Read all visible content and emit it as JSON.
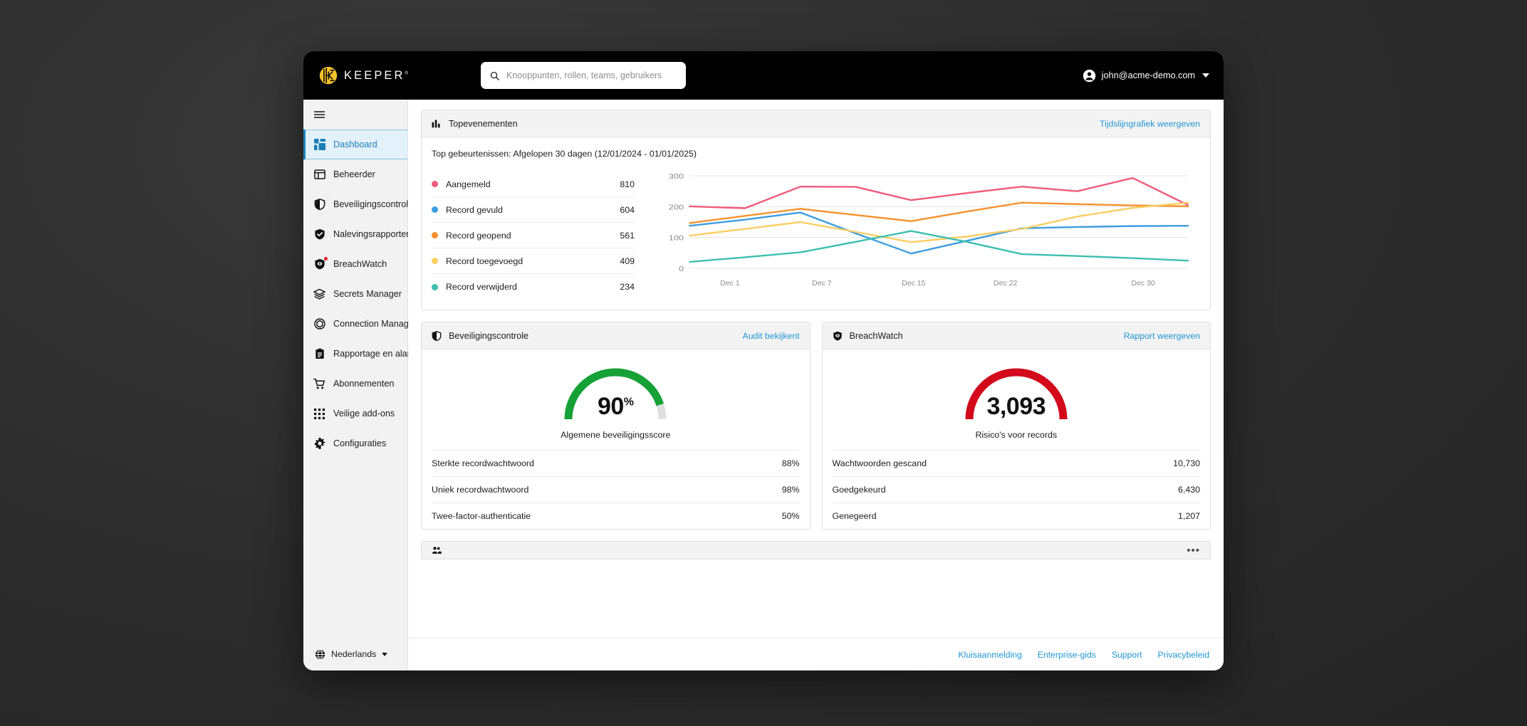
{
  "app": {
    "brand": "KEEPER",
    "brand_tm": "®"
  },
  "topbar": {
    "search": {
      "placeholder": "Knooppunten, rollen, teams, gebruikers",
      "value": "",
      "icon": "search-icon"
    },
    "user": {
      "email": "john@acme-demo.com",
      "avatar_icon": "account-circle-icon",
      "caret_icon": "chevron-down-icon"
    }
  },
  "sidebar": {
    "menu_toggle_icon": "hamburger-icon",
    "items": [
      {
        "label": "Dashboard",
        "icon": "dashboard-grid-icon",
        "active": true,
        "badge": false
      },
      {
        "label": "Beheerder",
        "icon": "admin-panel-icon",
        "active": false,
        "badge": false
      },
      {
        "label": "Beveiligingscontrole",
        "icon": "shield-outline-icon",
        "active": false,
        "badge": false
      },
      {
        "label": "Nalevingsrapporten",
        "icon": "shield-check-icon",
        "active": false,
        "badge": false
      },
      {
        "label": "BreachWatch",
        "icon": "breachwatch-shield-icon",
        "active": false,
        "badge": true
      },
      {
        "label": "Secrets Manager",
        "icon": "layers-icon",
        "active": false,
        "badge": false
      },
      {
        "label": "Connection Manager",
        "icon": "hexagon-node-icon",
        "active": false,
        "badge": false
      },
      {
        "label": "Rapportage en alarmen",
        "icon": "clipboard-icon",
        "active": false,
        "badge": false
      },
      {
        "label": "Abonnementen",
        "icon": "shopping-cart-icon",
        "active": false,
        "badge": false
      },
      {
        "label": "Veilige add-ons",
        "icon": "apps-grid-icon",
        "active": false,
        "badge": false
      },
      {
        "label": "Configuraties",
        "icon": "gear-icon",
        "active": false,
        "badge": false
      }
    ],
    "language": {
      "label": "Nederlands",
      "icon": "globe-icon",
      "caret_icon": "caret-down-icon"
    }
  },
  "top_events_card": {
    "title": "Topevenementen",
    "icon": "bar-chart-icon",
    "link": "Tijdslijngrafiek weergeven",
    "subtitle": "Top gebeurtenissen: Afgelopen 30 dagen (12/01/2024 - 01/01/2025)",
    "legend": [
      {
        "label": "Aangemeld",
        "value": "810",
        "color": "#ef5b7d"
      },
      {
        "label": "Record gevuld",
        "value": "604",
        "color": "#3d9de0"
      },
      {
        "label": "Record geopend",
        "value": "561",
        "color": "#f5922f"
      },
      {
        "label": "Record toegevoegd",
        "value": "409",
        "color": "#fbce62"
      },
      {
        "label": "Record verwijderd",
        "value": "234",
        "color": "#3cbfb0"
      }
    ]
  },
  "chart_data": {
    "type": "line",
    "title": "Top gebeurtenissen: Afgelopen 30 dagen (12/01/2024 - 01/01/2025)",
    "xlabel": "",
    "ylabel": "",
    "ylim": [
      0,
      300
    ],
    "yticks": [
      0,
      100,
      200,
      300
    ],
    "grid": true,
    "legend_position": "left",
    "x": [
      "Dec 1",
      "Dec 4",
      "Dec 7",
      "Dec 11",
      "Dec 15",
      "Dec 18",
      "Dec 22",
      "Dec 25",
      "Dec 27",
      "Dec 30"
    ],
    "xtick_labels": [
      "Dec 1",
      "Dec 7",
      "Dec 15",
      "Dec 22",
      "Dec 30"
    ],
    "series": [
      {
        "name": "Aangemeld",
        "color": "#ef5b7d",
        "total": 810,
        "values": [
          201,
          195,
          265,
          264,
          221,
          244,
          265,
          250,
          293,
          205
        ]
      },
      {
        "name": "Record gevuld",
        "color": "#3d9de0",
        "total": 604,
        "values": [
          138,
          158,
          181,
          113,
          48,
          89,
          130,
          134,
          137,
          138
        ]
      },
      {
        "name": "Record geopend",
        "color": "#f5922f",
        "total": 561,
        "values": [
          147,
          170,
          193,
          173,
          153,
          184,
          213,
          208,
          204,
          201
        ]
      },
      {
        "name": "Record toegevoegd",
        "color": "#fbce62",
        "total": 409,
        "values": [
          106,
          128,
          150,
          118,
          85,
          103,
          128,
          168,
          196,
          213
        ]
      },
      {
        "name": "Record verwijderd",
        "color": "#3cbfb0",
        "total": 234,
        "values": [
          21,
          36,
          52,
          86,
          121,
          86,
          46,
          40,
          33,
          25
        ]
      }
    ]
  },
  "security_audit_card": {
    "title": "Beveiligingscontrole",
    "icon": "shield-outline-icon",
    "link": "Audit bekijkent",
    "gauge": {
      "value": "90",
      "unit": "%",
      "percent": 90,
      "caption": "Algemene beveiligingsscore",
      "color": "#16a136",
      "track_color": "#e0e0e0"
    },
    "metrics": [
      {
        "label": "Sterkte recordwachtwoord",
        "value": "88%"
      },
      {
        "label": "Uniek recordwachtwoord",
        "value": "98%"
      },
      {
        "label": "Twee-factor-authenticatie",
        "value": "50%"
      }
    ]
  },
  "breachwatch_card": {
    "title": "BreachWatch",
    "icon": "breachwatch-shield-icon",
    "link": "Rapport weergeven",
    "gauge": {
      "value": "3,093",
      "unit": "",
      "percent": 100,
      "caption": "Risico's voor records",
      "color": "#d3091c",
      "track_color": "#e0e0e0"
    },
    "metrics": [
      {
        "label": "Wachtwoorden gescand",
        "value": "10,730"
      },
      {
        "label": "Goedgekeurd",
        "value": "6,430"
      },
      {
        "label": "Genegeerd",
        "value": "1,207"
      }
    ]
  },
  "partial_card": {
    "icon": "people-icon",
    "overflow_icon": "more-horizontal-icon"
  },
  "footer": {
    "links": [
      "Kluisaanmelding",
      "Enterprise-gids",
      "Support",
      "Privacybeleid"
    ]
  },
  "colors": {
    "accent": "#2196d4",
    "brand_yellow": "#f3c12c",
    "topbar_bg": "#000000",
    "sidebar_bg": "#f2f2f2",
    "active_bg": "#e3f1fa"
  }
}
